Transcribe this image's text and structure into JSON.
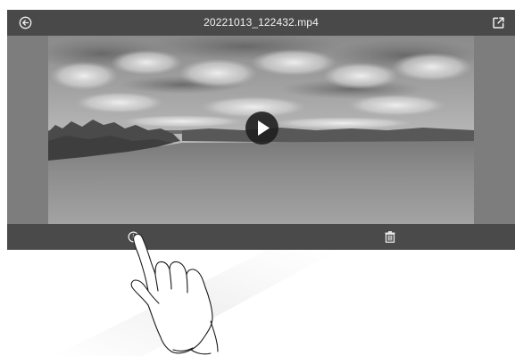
{
  "player": {
    "file_name": "20221013_122432.mp4"
  },
  "icons": {
    "back": "back-arrow-circle-icon",
    "open_external": "open-external-icon",
    "play": "play-icon",
    "info": "info-icon",
    "delete": "trash-icon",
    "hand": "tap-hand-pointer"
  },
  "colors": {
    "top_bar": "#464646",
    "bottom_bar": "#4a4a4a",
    "side_bars": "#7d7d7d",
    "play_button": "#1f1f1f",
    "icon": "#f2f2f2"
  }
}
